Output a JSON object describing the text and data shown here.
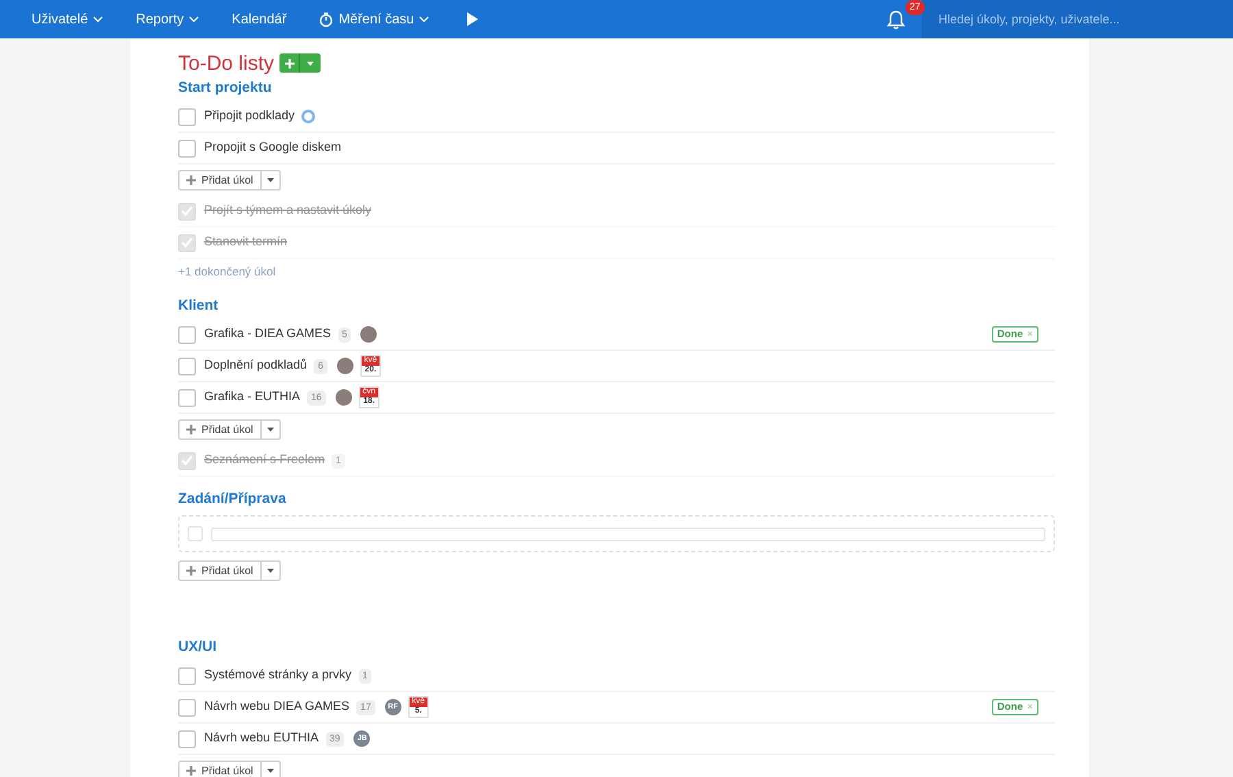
{
  "nav": {
    "items": [
      {
        "kind": "menu",
        "label": "Uživatelé",
        "caret": true
      },
      {
        "kind": "menu",
        "label": "Reporty",
        "caret": true
      },
      {
        "kind": "menu",
        "label": "Kalendář",
        "caret": false
      },
      {
        "kind": "timer",
        "label": "Měření času",
        "caret": true
      },
      {
        "kind": "play"
      }
    ],
    "notifications": {
      "count": "27"
    },
    "search": {
      "placeholder": "Hledej úkoly, projekty, uživatele..."
    }
  },
  "title": "To-Do listy",
  "lists": [
    {
      "title": "Start projektu",
      "tasks": [
        {
          "kind": "task",
          "label": "Připojit podklady",
          "checked": false,
          "loading": true
        },
        {
          "kind": "task",
          "label": "Propojit s Google diskem",
          "checked": false
        }
      ],
      "add_button": "Přidat úkol",
      "completed": [
        {
          "label": "Projít s týmem a nastavit úkoly",
          "checked": true
        },
        {
          "label": "Stanovit termín",
          "checked": true
        }
      ],
      "completed_note": "+1 dokončený úkol"
    },
    {
      "title": "Klient",
      "tasks": [
        {
          "kind": "task",
          "label": "Grafika - DIEA GAMES",
          "checked": false,
          "count": "5",
          "avatar": {
            "kind": "photo"
          },
          "tag": {
            "label": "Done",
            "close": "×"
          }
        },
        {
          "kind": "task",
          "label": "Doplnění podkladů",
          "checked": false,
          "count": "6",
          "avatar": {
            "kind": "photo"
          },
          "date": {
            "month": "kvě",
            "day": "20."
          }
        },
        {
          "kind": "task",
          "label": "Grafika - EUTHIA",
          "checked": false,
          "count": "16",
          "avatar": {
            "kind": "photo"
          },
          "date": {
            "month": "čvn",
            "day": "18."
          }
        }
      ],
      "add_button": "Přidat úkol",
      "completed": [
        {
          "label": "Seznámení s Freelem",
          "checked": true,
          "count": "1"
        }
      ]
    },
    {
      "title": "Zadání/Příprava",
      "tasks": [
        {
          "kind": "draft",
          "checked": false
        }
      ],
      "add_button": "Přidat úkol"
    },
    {
      "title": "UX/UI",
      "tasks": [
        {
          "kind": "task",
          "label": "Systémové stránky a prvky",
          "checked": false,
          "count": "1"
        },
        {
          "kind": "task",
          "label": "Návrh webu DIEA GAMES",
          "checked": false,
          "count": "17",
          "avatar": {
            "kind": "initials",
            "initials": "RF"
          },
          "date": {
            "month": "kvě",
            "day": "5."
          },
          "tag": {
            "label": "Done",
            "close": "×"
          }
        },
        {
          "kind": "task",
          "label": "Návrh webu EUTHIA",
          "checked": false,
          "count": "39",
          "avatar": {
            "kind": "initials",
            "initials": "JB"
          }
        }
      ],
      "add_button": "Přidat úkol"
    }
  ]
}
